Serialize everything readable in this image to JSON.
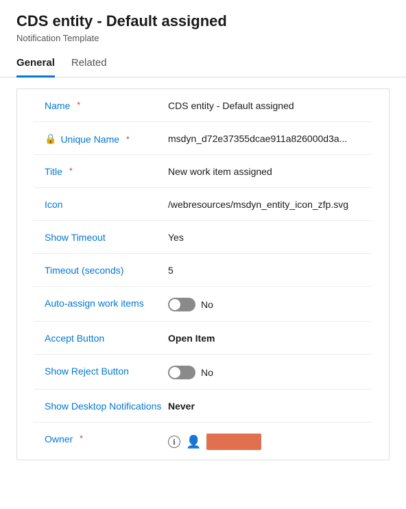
{
  "header": {
    "title": "CDS entity - Default assigned",
    "subtitle": "Notification Template"
  },
  "tabs": [
    {
      "id": "general",
      "label": "General",
      "active": true
    },
    {
      "id": "related",
      "label": "Related",
      "active": false
    }
  ],
  "fields": [
    {
      "id": "name",
      "label": "Name",
      "required": true,
      "value": "CDS entity - Default assigned",
      "bold": false,
      "type": "text"
    },
    {
      "id": "unique-name",
      "label": "Unique Name",
      "required": true,
      "value": "msdyn_d72e37355dcae911a826000d3a...",
      "bold": false,
      "type": "text",
      "lock": true
    },
    {
      "id": "title",
      "label": "Title",
      "required": true,
      "value": "New work item assigned",
      "bold": false,
      "type": "text"
    },
    {
      "id": "icon",
      "label": "Icon",
      "required": false,
      "value": "/webresources/msdyn_entity_icon_zfp.svg",
      "bold": false,
      "type": "text"
    },
    {
      "id": "show-timeout",
      "label": "Show Timeout",
      "required": false,
      "value": "Yes",
      "bold": false,
      "type": "text"
    },
    {
      "id": "timeout-seconds",
      "label": "Timeout (seconds)",
      "required": false,
      "value": "5",
      "bold": false,
      "type": "text"
    },
    {
      "id": "auto-assign",
      "label": "Auto-assign work items",
      "required": false,
      "value": "No",
      "bold": false,
      "type": "toggle"
    },
    {
      "id": "accept-button",
      "label": "Accept Button",
      "required": false,
      "value": "Open Item",
      "bold": true,
      "type": "text"
    },
    {
      "id": "show-reject",
      "label": "Show Reject Button",
      "required": false,
      "value": "No",
      "bold": false,
      "type": "toggle"
    },
    {
      "id": "show-desktop",
      "label": "Show Desktop Notifications",
      "required": false,
      "value": "Never",
      "bold": true,
      "type": "text"
    },
    {
      "id": "owner",
      "label": "Owner",
      "required": true,
      "value": "",
      "bold": false,
      "type": "owner"
    }
  ],
  "toggles": {
    "auto_assign_label": "No",
    "show_reject_label": "No"
  },
  "icons": {
    "lock": "🔒",
    "info": "ℹ",
    "person": "👤"
  }
}
